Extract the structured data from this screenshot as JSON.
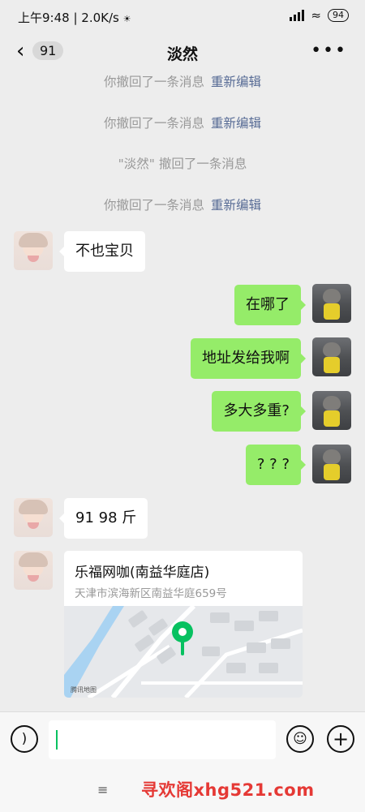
{
  "status_bar": {
    "time": "上午9:48",
    "speed": "2.0K/s",
    "battery": "94"
  },
  "nav": {
    "back_icon": "chevron-left-icon",
    "unread_count": "91",
    "title": "淡然",
    "more_icon": "more-dots-icon"
  },
  "system_messages": [
    {
      "text": "你撤回了一条消息",
      "link": "重新编辑"
    },
    {
      "text": "你撤回了一条消息",
      "link": "重新编辑"
    },
    {
      "text": "\"淡然\" 撤回了一条消息",
      "link": ""
    },
    {
      "text": "你撤回了一条消息",
      "link": "重新编辑"
    }
  ],
  "messages": [
    {
      "side": "in",
      "text": "不也宝贝"
    },
    {
      "side": "out",
      "text": "在哪了"
    },
    {
      "side": "out",
      "text": "地址发给我啊"
    },
    {
      "side": "out",
      "text": "多大多重?"
    },
    {
      "side": "out",
      "text": "? ? ?"
    },
    {
      "side": "in",
      "text": "91  98 斤"
    }
  ],
  "location": {
    "name": "乐福网咖(南益华庭店)",
    "address": "天津市滨海新区南益华庭659号",
    "map_credit": "腾讯地图",
    "pin_color": "#07c160"
  },
  "input_bar": {
    "voice_icon": "voice-icon",
    "emoji_icon": "emoji-icon",
    "add_icon": "plus-icon",
    "value": ""
  },
  "colors": {
    "outgoing_bubble": "#95ec69",
    "incoming_bubble": "#ffffff",
    "link": "#576b95",
    "background": "#ededed"
  },
  "watermark": "寻欢阁xhg521.com",
  "nav_bar_icon": "menu-icon"
}
